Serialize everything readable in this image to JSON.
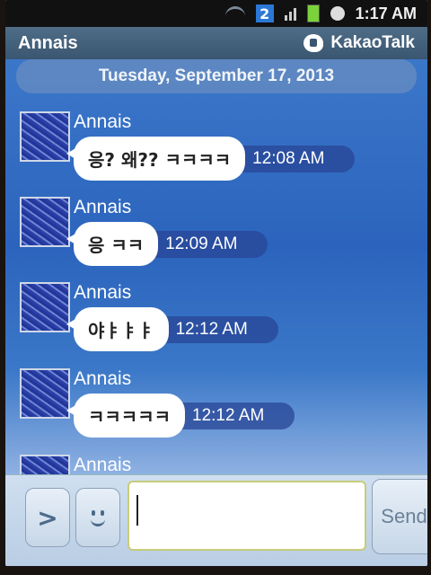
{
  "status_bar": {
    "notification_count": "2",
    "time": "1:17 AM",
    "icons": [
      "wifi-icon",
      "signal-icon",
      "battery-icon",
      "alarm-icon"
    ]
  },
  "header": {
    "chat_title": "Annais",
    "brand": "KakaoTalk"
  },
  "chat": {
    "date": "Tuesday, September 17, 2013",
    "messages": [
      {
        "sender": "Annais",
        "text": "응? 왜?? ㅋㅋㅋㅋ",
        "time": "12:08 AM"
      },
      {
        "sender": "Annais",
        "text": "응 ㅋㅋ",
        "time": "12:09 AM"
      },
      {
        "sender": "Annais",
        "text": "야ㅑㅑㅑ",
        "time": "12:12 AM"
      },
      {
        "sender": "Annais",
        "text": "ㅋㅋㅋㅋㅋ",
        "time": "12:12 AM"
      },
      {
        "sender": "Annais"
      }
    ]
  },
  "input_bar": {
    "message_value": "",
    "send_label": "Send",
    "expand_glyph": ">"
  },
  "colors": {
    "chat_background": "#2c64bd",
    "header_background": "#3a5671",
    "bubble": "#ffffff"
  }
}
